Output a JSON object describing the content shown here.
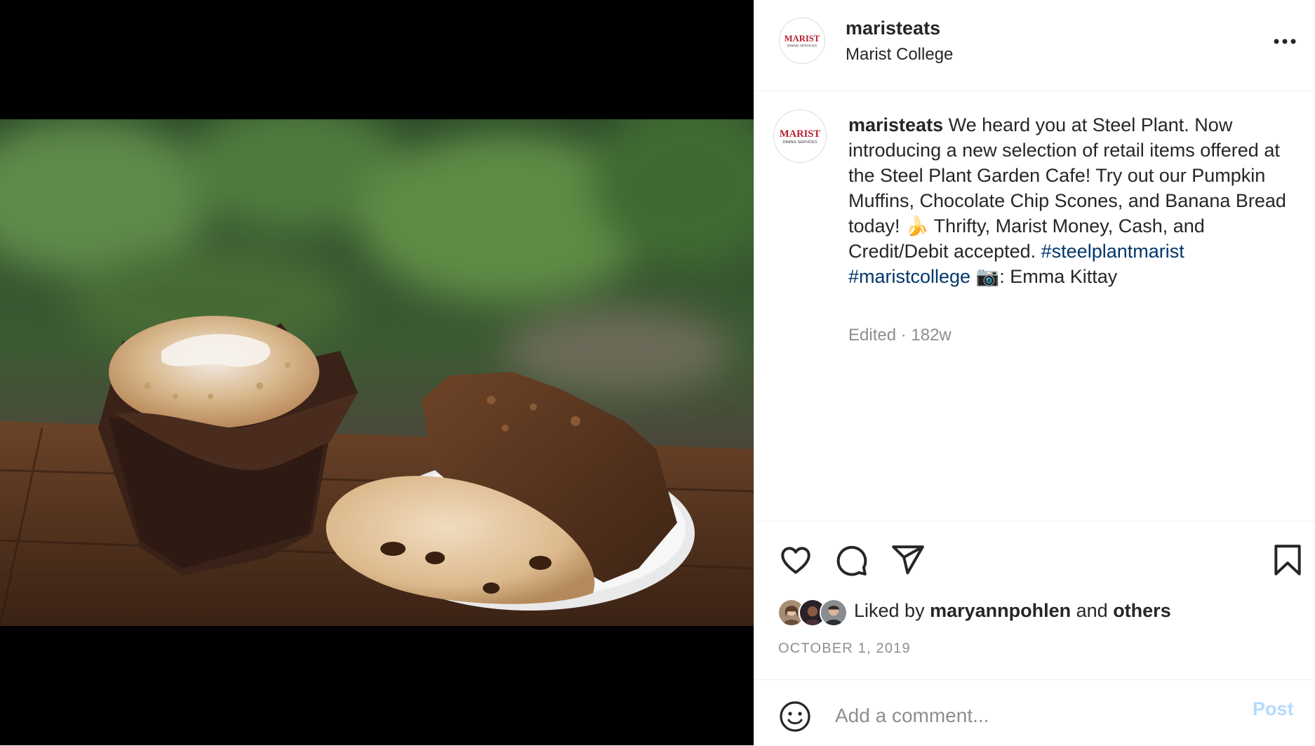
{
  "post": {
    "username": "maristeats",
    "location": "Marist College",
    "avatar_logo": {
      "line1": "MARIST",
      "line2": "DINING SERVICES"
    },
    "caption": {
      "username": "maristeats",
      "text_before": " We heard you at Steel Plant. Now introducing a new selection of retail items offered at the Steel Plant Garden Cafe! Try out our Pumpkin Muffins, Chocolate Chip Scones, and Banana Bread today! 🍌 Thrifty, Marist Money, Cash, and Credit/Debit accepted. ",
      "hashtags": [
        "#steelplantmarist",
        "#maristcollege"
      ],
      "camera_emoji": "📷",
      "text_after": ": Emma Kittay"
    },
    "meta": "Edited · 182w",
    "likes": {
      "prefix": "Liked by ",
      "user": "maryannpohlen",
      "middle": " and ",
      "others": "others"
    },
    "date": "OCTOBER 1, 2019",
    "comment_placeholder": "Add a comment...",
    "post_label": "Post"
  },
  "icons": {
    "more": "more-options-icon",
    "like": "heart-icon",
    "comment": "comment-bubble-icon",
    "share": "paper-plane-icon",
    "save": "bookmark-icon",
    "emoji": "smiley-icon"
  },
  "colors": {
    "logo_red": "#b8202e",
    "hashtag": "#00376b",
    "muted": "#8e8e8e",
    "post_button_disabled": "#b3dbff"
  }
}
